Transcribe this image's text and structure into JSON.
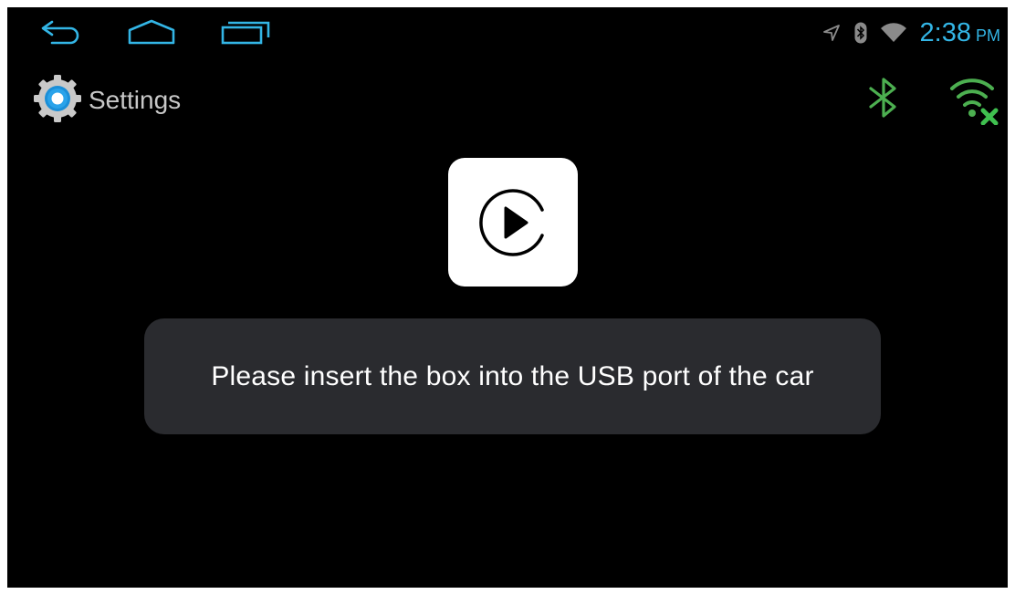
{
  "navigation": {
    "back_icon": "back-arrow-icon",
    "home_icon": "home-icon",
    "recent_icon": "recent-apps-icon"
  },
  "status_bar": {
    "icons": [
      "location-icon",
      "bluetooth-icon",
      "wifi-icon"
    ],
    "time": "2:38",
    "ampm": "PM",
    "clock_color": "#33b5e5"
  },
  "header": {
    "app_icon": "settings-gear-icon",
    "title": "Settings"
  },
  "quick_icons": {
    "bluetooth": "bluetooth-icon",
    "wifi": "wifi-disconnected-icon",
    "accent_color": "#4caf50",
    "alert_color": "#43a047"
  },
  "main": {
    "app_logo": "carplay-play-icon",
    "message": "Please insert the box into the USB port of the car"
  }
}
